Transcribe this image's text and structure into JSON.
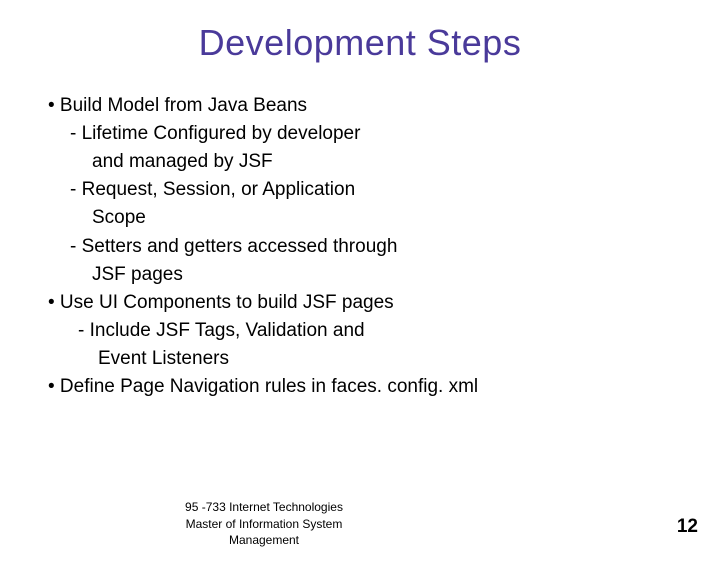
{
  "title": "Development Steps",
  "lines": [
    {
      "cls": "bullet",
      "text": "•  Build Model from Java Beans"
    },
    {
      "cls": "sub1",
      "text": "- Lifetime Configured by developer"
    },
    {
      "cls": "sub1-cont",
      "text": "and managed by JSF"
    },
    {
      "cls": "sub1",
      "text": "- Request, Session, or Application"
    },
    {
      "cls": "sub1-cont",
      "text": "Scope"
    },
    {
      "cls": "sub1",
      "text": "- Setters and getters accessed through"
    },
    {
      "cls": "sub1-cont",
      "text": "JSF pages"
    },
    {
      "cls": "bullet",
      "text": "•  Use UI Components to build JSF pages"
    },
    {
      "cls": "sub2",
      "text": "- Include JSF Tags, Validation and"
    },
    {
      "cls": "sub2-cont",
      "text": "Event Listeners"
    },
    {
      "cls": "bullet",
      "text": "•  Define Page Navigation rules in faces. config. xml"
    }
  ],
  "footer": {
    "line1": "95 -733 Internet Technologies",
    "line2": "Master of Information System",
    "line3": "Management"
  },
  "page_number": "12"
}
